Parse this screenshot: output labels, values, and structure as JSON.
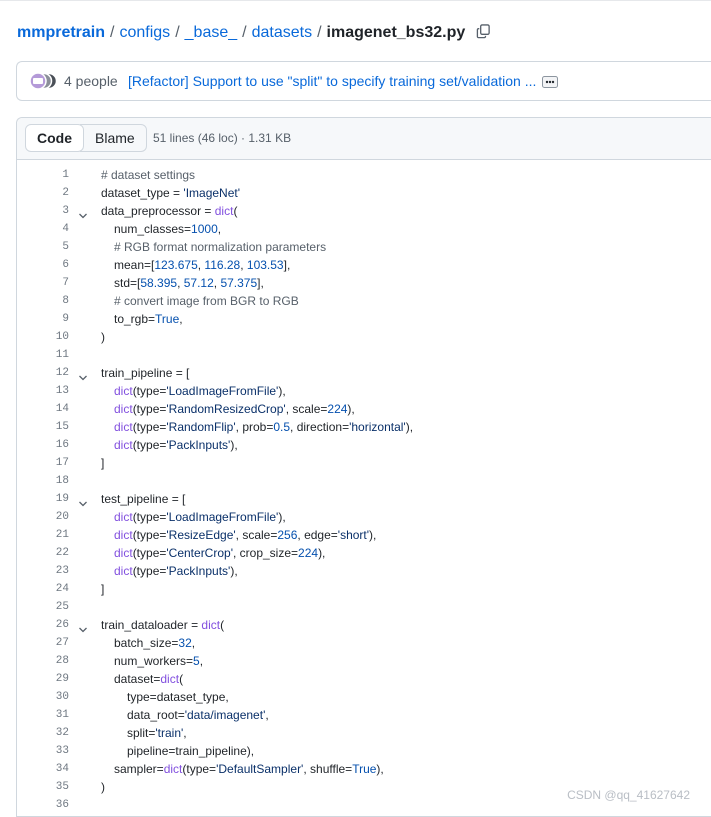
{
  "breadcrumb": {
    "repo": "mmpretrain",
    "parts": [
      "configs",
      "_base_",
      "datasets"
    ],
    "file": "imagenet_bs32.py",
    "separator": "/"
  },
  "commit": {
    "people": "4 people",
    "message": "[Refactor] Support to use \"split\" to specify training set/validation ..."
  },
  "file_header": {
    "code_tab": "Code",
    "blame_tab": "Blame",
    "info": "51 lines (46 loc) · 1.31 KB"
  },
  "code_lines": [
    {
      "n": "1",
      "fold": false,
      "indent": 0,
      "tokens": [
        [
          "cm",
          "# dataset settings"
        ]
      ]
    },
    {
      "n": "2",
      "fold": false,
      "indent": 0,
      "tokens": [
        [
          "",
          "dataset_type = "
        ],
        [
          "st",
          "'ImageNet'"
        ]
      ]
    },
    {
      "n": "3",
      "fold": true,
      "indent": 0,
      "tokens": [
        [
          "",
          "data_preprocessor = "
        ],
        [
          "fn",
          "dict"
        ],
        [
          "",
          "("
        ]
      ]
    },
    {
      "n": "4",
      "fold": false,
      "indent": 1,
      "tokens": [
        [
          "",
          "num_classes="
        ],
        [
          "nu",
          "1000"
        ],
        [
          "",
          ","
        ]
      ]
    },
    {
      "n": "5",
      "fold": false,
      "indent": 1,
      "tokens": [
        [
          "cm",
          "# RGB format normalization parameters"
        ]
      ]
    },
    {
      "n": "6",
      "fold": false,
      "indent": 1,
      "tokens": [
        [
          "",
          "mean=["
        ],
        [
          "nu",
          "123.675"
        ],
        [
          "",
          ", "
        ],
        [
          "nu",
          "116.28"
        ],
        [
          "",
          ", "
        ],
        [
          "nu",
          "103.53"
        ],
        [
          "",
          "],"
        ]
      ]
    },
    {
      "n": "7",
      "fold": false,
      "indent": 1,
      "tokens": [
        [
          "",
          "std=["
        ],
        [
          "nu",
          "58.395"
        ],
        [
          "",
          ", "
        ],
        [
          "nu",
          "57.12"
        ],
        [
          "",
          ", "
        ],
        [
          "nu",
          "57.375"
        ],
        [
          "",
          "],"
        ]
      ]
    },
    {
      "n": "8",
      "fold": false,
      "indent": 1,
      "tokens": [
        [
          "cm",
          "# convert image from BGR to RGB"
        ]
      ]
    },
    {
      "n": "9",
      "fold": false,
      "indent": 1,
      "tokens": [
        [
          "",
          "to_rgb="
        ],
        [
          "kw",
          "True"
        ],
        [
          "",
          ","
        ]
      ]
    },
    {
      "n": "10",
      "fold": false,
      "indent": 0,
      "tokens": [
        [
          "",
          ")"
        ]
      ]
    },
    {
      "n": "11",
      "fold": false,
      "indent": 0,
      "tokens": []
    },
    {
      "n": "12",
      "fold": true,
      "indent": 0,
      "tokens": [
        [
          "",
          "train_pipeline = ["
        ]
      ]
    },
    {
      "n": "13",
      "fold": false,
      "indent": 1,
      "tokens": [
        [
          "fn",
          "dict"
        ],
        [
          "",
          "(type="
        ],
        [
          "st",
          "'LoadImageFromFile'"
        ],
        [
          "",
          "),"
        ]
      ]
    },
    {
      "n": "14",
      "fold": false,
      "indent": 1,
      "tokens": [
        [
          "fn",
          "dict"
        ],
        [
          "",
          "(type="
        ],
        [
          "st",
          "'RandomResizedCrop'"
        ],
        [
          "",
          ", scale="
        ],
        [
          "nu",
          "224"
        ],
        [
          "",
          "),"
        ]
      ]
    },
    {
      "n": "15",
      "fold": false,
      "indent": 1,
      "tokens": [
        [
          "fn",
          "dict"
        ],
        [
          "",
          "(type="
        ],
        [
          "st",
          "'RandomFlip'"
        ],
        [
          "",
          ", prob="
        ],
        [
          "nu",
          "0.5"
        ],
        [
          "",
          ", direction="
        ],
        [
          "st",
          "'horizontal'"
        ],
        [
          "",
          "),"
        ]
      ]
    },
    {
      "n": "16",
      "fold": false,
      "indent": 1,
      "tokens": [
        [
          "fn",
          "dict"
        ],
        [
          "",
          "(type="
        ],
        [
          "st",
          "'PackInputs'"
        ],
        [
          "",
          "),"
        ]
      ]
    },
    {
      "n": "17",
      "fold": false,
      "indent": 0,
      "tokens": [
        [
          "",
          "]"
        ]
      ]
    },
    {
      "n": "18",
      "fold": false,
      "indent": 0,
      "tokens": []
    },
    {
      "n": "19",
      "fold": true,
      "indent": 0,
      "tokens": [
        [
          "",
          "test_pipeline = ["
        ]
      ]
    },
    {
      "n": "20",
      "fold": false,
      "indent": 1,
      "tokens": [
        [
          "fn",
          "dict"
        ],
        [
          "",
          "(type="
        ],
        [
          "st",
          "'LoadImageFromFile'"
        ],
        [
          "",
          "),"
        ]
      ]
    },
    {
      "n": "21",
      "fold": false,
      "indent": 1,
      "tokens": [
        [
          "fn",
          "dict"
        ],
        [
          "",
          "(type="
        ],
        [
          "st",
          "'ResizeEdge'"
        ],
        [
          "",
          ", scale="
        ],
        [
          "nu",
          "256"
        ],
        [
          "",
          ", edge="
        ],
        [
          "st",
          "'short'"
        ],
        [
          "",
          "),"
        ]
      ]
    },
    {
      "n": "22",
      "fold": false,
      "indent": 1,
      "tokens": [
        [
          "fn",
          "dict"
        ],
        [
          "",
          "(type="
        ],
        [
          "st",
          "'CenterCrop'"
        ],
        [
          "",
          ", crop_size="
        ],
        [
          "nu",
          "224"
        ],
        [
          "",
          "),"
        ]
      ]
    },
    {
      "n": "23",
      "fold": false,
      "indent": 1,
      "tokens": [
        [
          "fn",
          "dict"
        ],
        [
          "",
          "(type="
        ],
        [
          "st",
          "'PackInputs'"
        ],
        [
          "",
          "),"
        ]
      ]
    },
    {
      "n": "24",
      "fold": false,
      "indent": 0,
      "tokens": [
        [
          "",
          "]"
        ]
      ]
    },
    {
      "n": "25",
      "fold": false,
      "indent": 0,
      "tokens": []
    },
    {
      "n": "26",
      "fold": true,
      "indent": 0,
      "tokens": [
        [
          "",
          "train_dataloader = "
        ],
        [
          "fn",
          "dict"
        ],
        [
          "",
          "("
        ]
      ]
    },
    {
      "n": "27",
      "fold": false,
      "indent": 1,
      "tokens": [
        [
          "",
          "batch_size="
        ],
        [
          "nu",
          "32"
        ],
        [
          "",
          ","
        ]
      ]
    },
    {
      "n": "28",
      "fold": false,
      "indent": 1,
      "tokens": [
        [
          "",
          "num_workers="
        ],
        [
          "nu",
          "5"
        ],
        [
          "",
          ","
        ]
      ]
    },
    {
      "n": "29",
      "fold": false,
      "indent": 1,
      "tokens": [
        [
          "",
          "dataset="
        ],
        [
          "fn",
          "dict"
        ],
        [
          "",
          "("
        ]
      ]
    },
    {
      "n": "30",
      "fold": false,
      "indent": 2,
      "tokens": [
        [
          "",
          "type=dataset_type,"
        ]
      ]
    },
    {
      "n": "31",
      "fold": false,
      "indent": 2,
      "tokens": [
        [
          "",
          "data_root="
        ],
        [
          "st",
          "'data/imagenet'"
        ],
        [
          "",
          ","
        ]
      ]
    },
    {
      "n": "32",
      "fold": false,
      "indent": 2,
      "tokens": [
        [
          "",
          "split="
        ],
        [
          "st",
          "'train'"
        ],
        [
          "",
          ","
        ]
      ]
    },
    {
      "n": "33",
      "fold": false,
      "indent": 2,
      "tokens": [
        [
          "",
          "pipeline=train_pipeline),"
        ]
      ]
    },
    {
      "n": "34",
      "fold": false,
      "indent": 1,
      "tokens": [
        [
          "",
          "sampler="
        ],
        [
          "fn",
          "dict"
        ],
        [
          "",
          "(type="
        ],
        [
          "st",
          "'DefaultSampler'"
        ],
        [
          "",
          ", shuffle="
        ],
        [
          "kw",
          "True"
        ],
        [
          "",
          "),"
        ]
      ]
    },
    {
      "n": "35",
      "fold": false,
      "indent": 0,
      "tokens": [
        [
          "",
          ")"
        ]
      ]
    },
    {
      "n": "36",
      "fold": false,
      "indent": 0,
      "tokens": []
    }
  ],
  "watermark": "CSDN @qq_41627642"
}
